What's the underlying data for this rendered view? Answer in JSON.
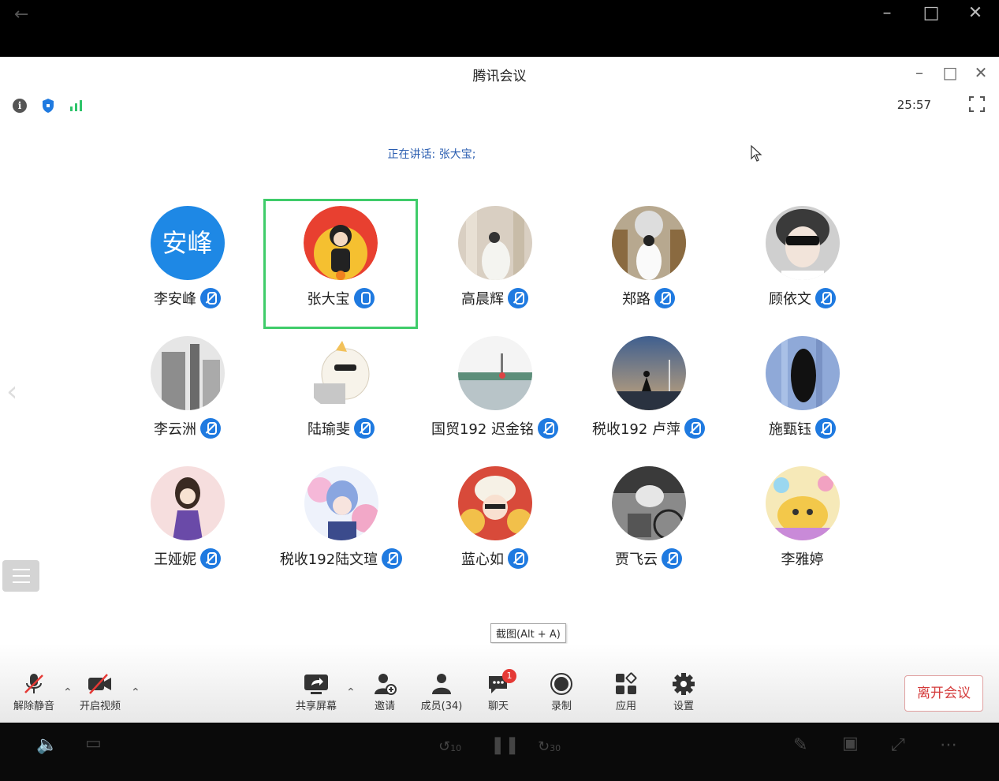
{
  "app": {
    "title": "腾讯会议",
    "timer": "25:57",
    "speaking": "正在讲话: 张大宝;"
  },
  "participants": [
    {
      "name": "李安峰",
      "avatar_text": "安峰",
      "mic": "off",
      "color": "#1e88e5"
    },
    {
      "name": "张大宝",
      "mic": "on",
      "active": true,
      "color": "#f0b020"
    },
    {
      "name": "高晨辉",
      "mic": "off",
      "color": "#d9cfc2"
    },
    {
      "name": "郑路",
      "mic": "off",
      "color": "#8a7f70"
    },
    {
      "name": "顾依文",
      "mic": "off",
      "color": "#6a6a6a"
    },
    {
      "name": "李云洲",
      "mic": "off",
      "color": "#9c9c9c"
    },
    {
      "name": "陆瑜斐",
      "mic": "off",
      "color": "#e9dfca"
    },
    {
      "name": "国贸192 迟金铭",
      "mic": "off",
      "color": "#7fa3b8"
    },
    {
      "name": "税收192 卢萍",
      "mic": "off",
      "color": "#5f7fa6"
    },
    {
      "name": "施甄钰",
      "mic": "off",
      "color": "#4f6fa8"
    },
    {
      "name": "王娅妮",
      "mic": "off",
      "color": "#f3c7c7"
    },
    {
      "name": "税收192陆文瑄",
      "mic": "off",
      "color": "#9db7e8"
    },
    {
      "name": "蓝心如",
      "mic": "off",
      "color": "#d84a3a"
    },
    {
      "name": "贾飞云",
      "mic": "off",
      "color": "#555555"
    },
    {
      "name": "李雅婷",
      "mic": "none",
      "color": "#f0d27a"
    }
  ],
  "tooltip": "截图(Alt + A)",
  "toolbar": {
    "unmute": "解除静音",
    "video": "开启视频",
    "share": "共享屏幕",
    "invite": "邀请",
    "members": "成员(34)",
    "chat": "聊天",
    "chat_badge": "1",
    "record": "录制",
    "apps": "应用",
    "settings": "设置",
    "leave": "离开会议"
  },
  "player": {
    "rewind": "10",
    "forward": "30"
  }
}
